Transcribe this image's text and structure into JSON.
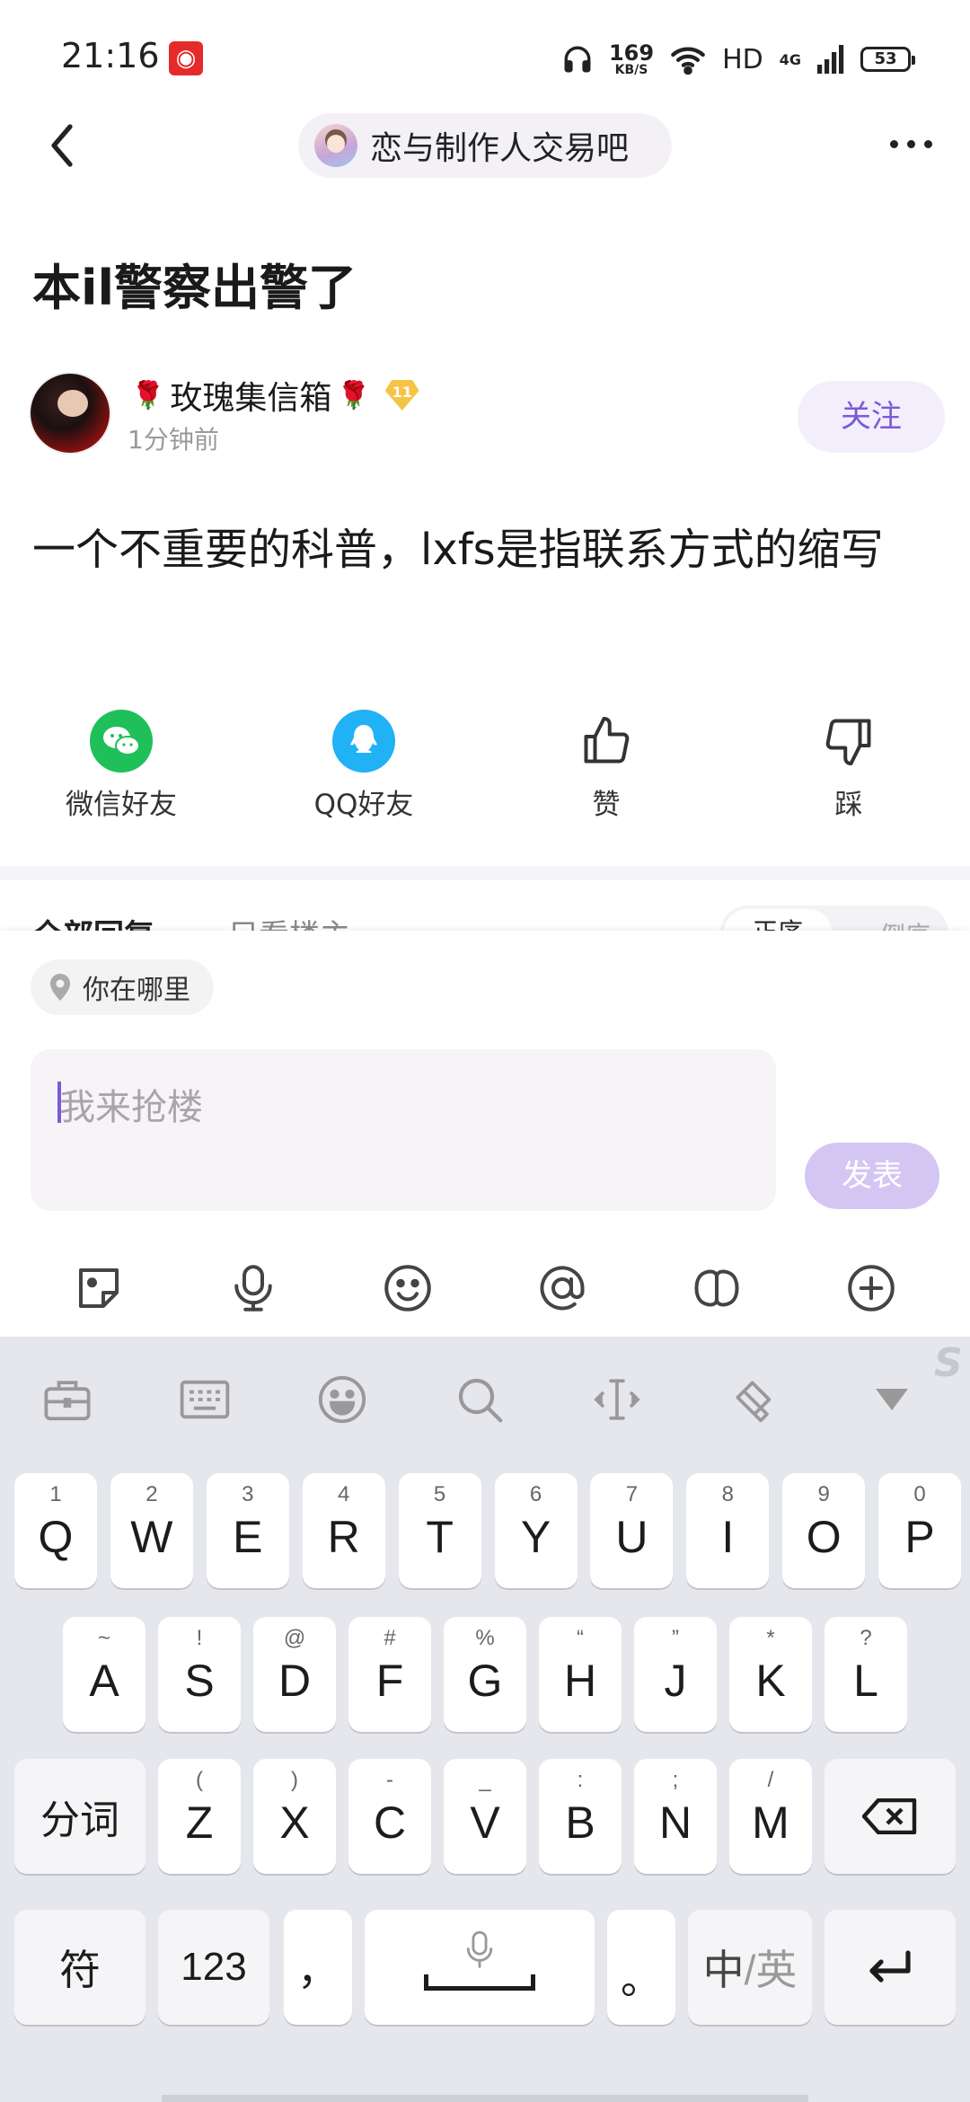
{
  "status_bar": {
    "time": "21:16",
    "net_speed_value": "169",
    "net_speed_unit": "KB/S",
    "hd_label": "HD",
    "network_label": "4G",
    "battery_level": "53"
  },
  "header": {
    "forum_name": "恋与制作人交易吧"
  },
  "post": {
    "title": "本il警察出警了",
    "author_name": "玫瑰集信箱",
    "author_level": "11",
    "time_ago": "1分钟前",
    "follow_label": "关注",
    "body": "一个不重要的科普，lxfs是指联系方式的缩写"
  },
  "actions": [
    {
      "label": "微信好友",
      "icon": "wechat-icon",
      "color": "#1fc05a"
    },
    {
      "label": "QQ好友",
      "icon": "qq-icon",
      "color": "#21b1f5"
    },
    {
      "label": "赞",
      "icon": "thumb-up-icon"
    },
    {
      "label": "踩",
      "icon": "thumb-down-icon"
    }
  ],
  "replies_peek": {
    "all_label": "全部回复",
    "op_only_label": "只看楼主",
    "sort_on": "正序",
    "sort_off": "倒序"
  },
  "compose": {
    "location_label": "你在哪里",
    "placeholder": "我来抢楼",
    "submit_label": "发表",
    "accent": "#7b5ad6"
  },
  "keyboard": {
    "row1": [
      {
        "main": "Q",
        "sub": "1"
      },
      {
        "main": "W",
        "sub": "2"
      },
      {
        "main": "E",
        "sub": "3"
      },
      {
        "main": "R",
        "sub": "4"
      },
      {
        "main": "T",
        "sub": "5"
      },
      {
        "main": "Y",
        "sub": "6"
      },
      {
        "main": "U",
        "sub": "7"
      },
      {
        "main": "I",
        "sub": "8"
      },
      {
        "main": "O",
        "sub": "9"
      },
      {
        "main": "P",
        "sub": "0"
      }
    ],
    "row2": [
      {
        "main": "A",
        "sub": "~"
      },
      {
        "main": "S",
        "sub": "!"
      },
      {
        "main": "D",
        "sub": "@"
      },
      {
        "main": "F",
        "sub": "#"
      },
      {
        "main": "G",
        "sub": "%"
      },
      {
        "main": "H",
        "sub": "“"
      },
      {
        "main": "J",
        "sub": "”"
      },
      {
        "main": "K",
        "sub": "*"
      },
      {
        "main": "L",
        "sub": "?"
      }
    ],
    "row3": [
      {
        "main": "Z",
        "sub": "("
      },
      {
        "main": "X",
        "sub": ")"
      },
      {
        "main": "C",
        "sub": "-"
      },
      {
        "main": "V",
        "sub": "_"
      },
      {
        "main": "B",
        "sub": ":"
      },
      {
        "main": "N",
        "sub": ";"
      },
      {
        "main": "M",
        "sub": "/"
      }
    ],
    "segment_label": "分词",
    "symbol_label": "符",
    "numbers_label": "123",
    "comma_label": "，",
    "period_label": "。",
    "lang_zh": "中",
    "lang_sep": "/",
    "lang_en": "英"
  }
}
